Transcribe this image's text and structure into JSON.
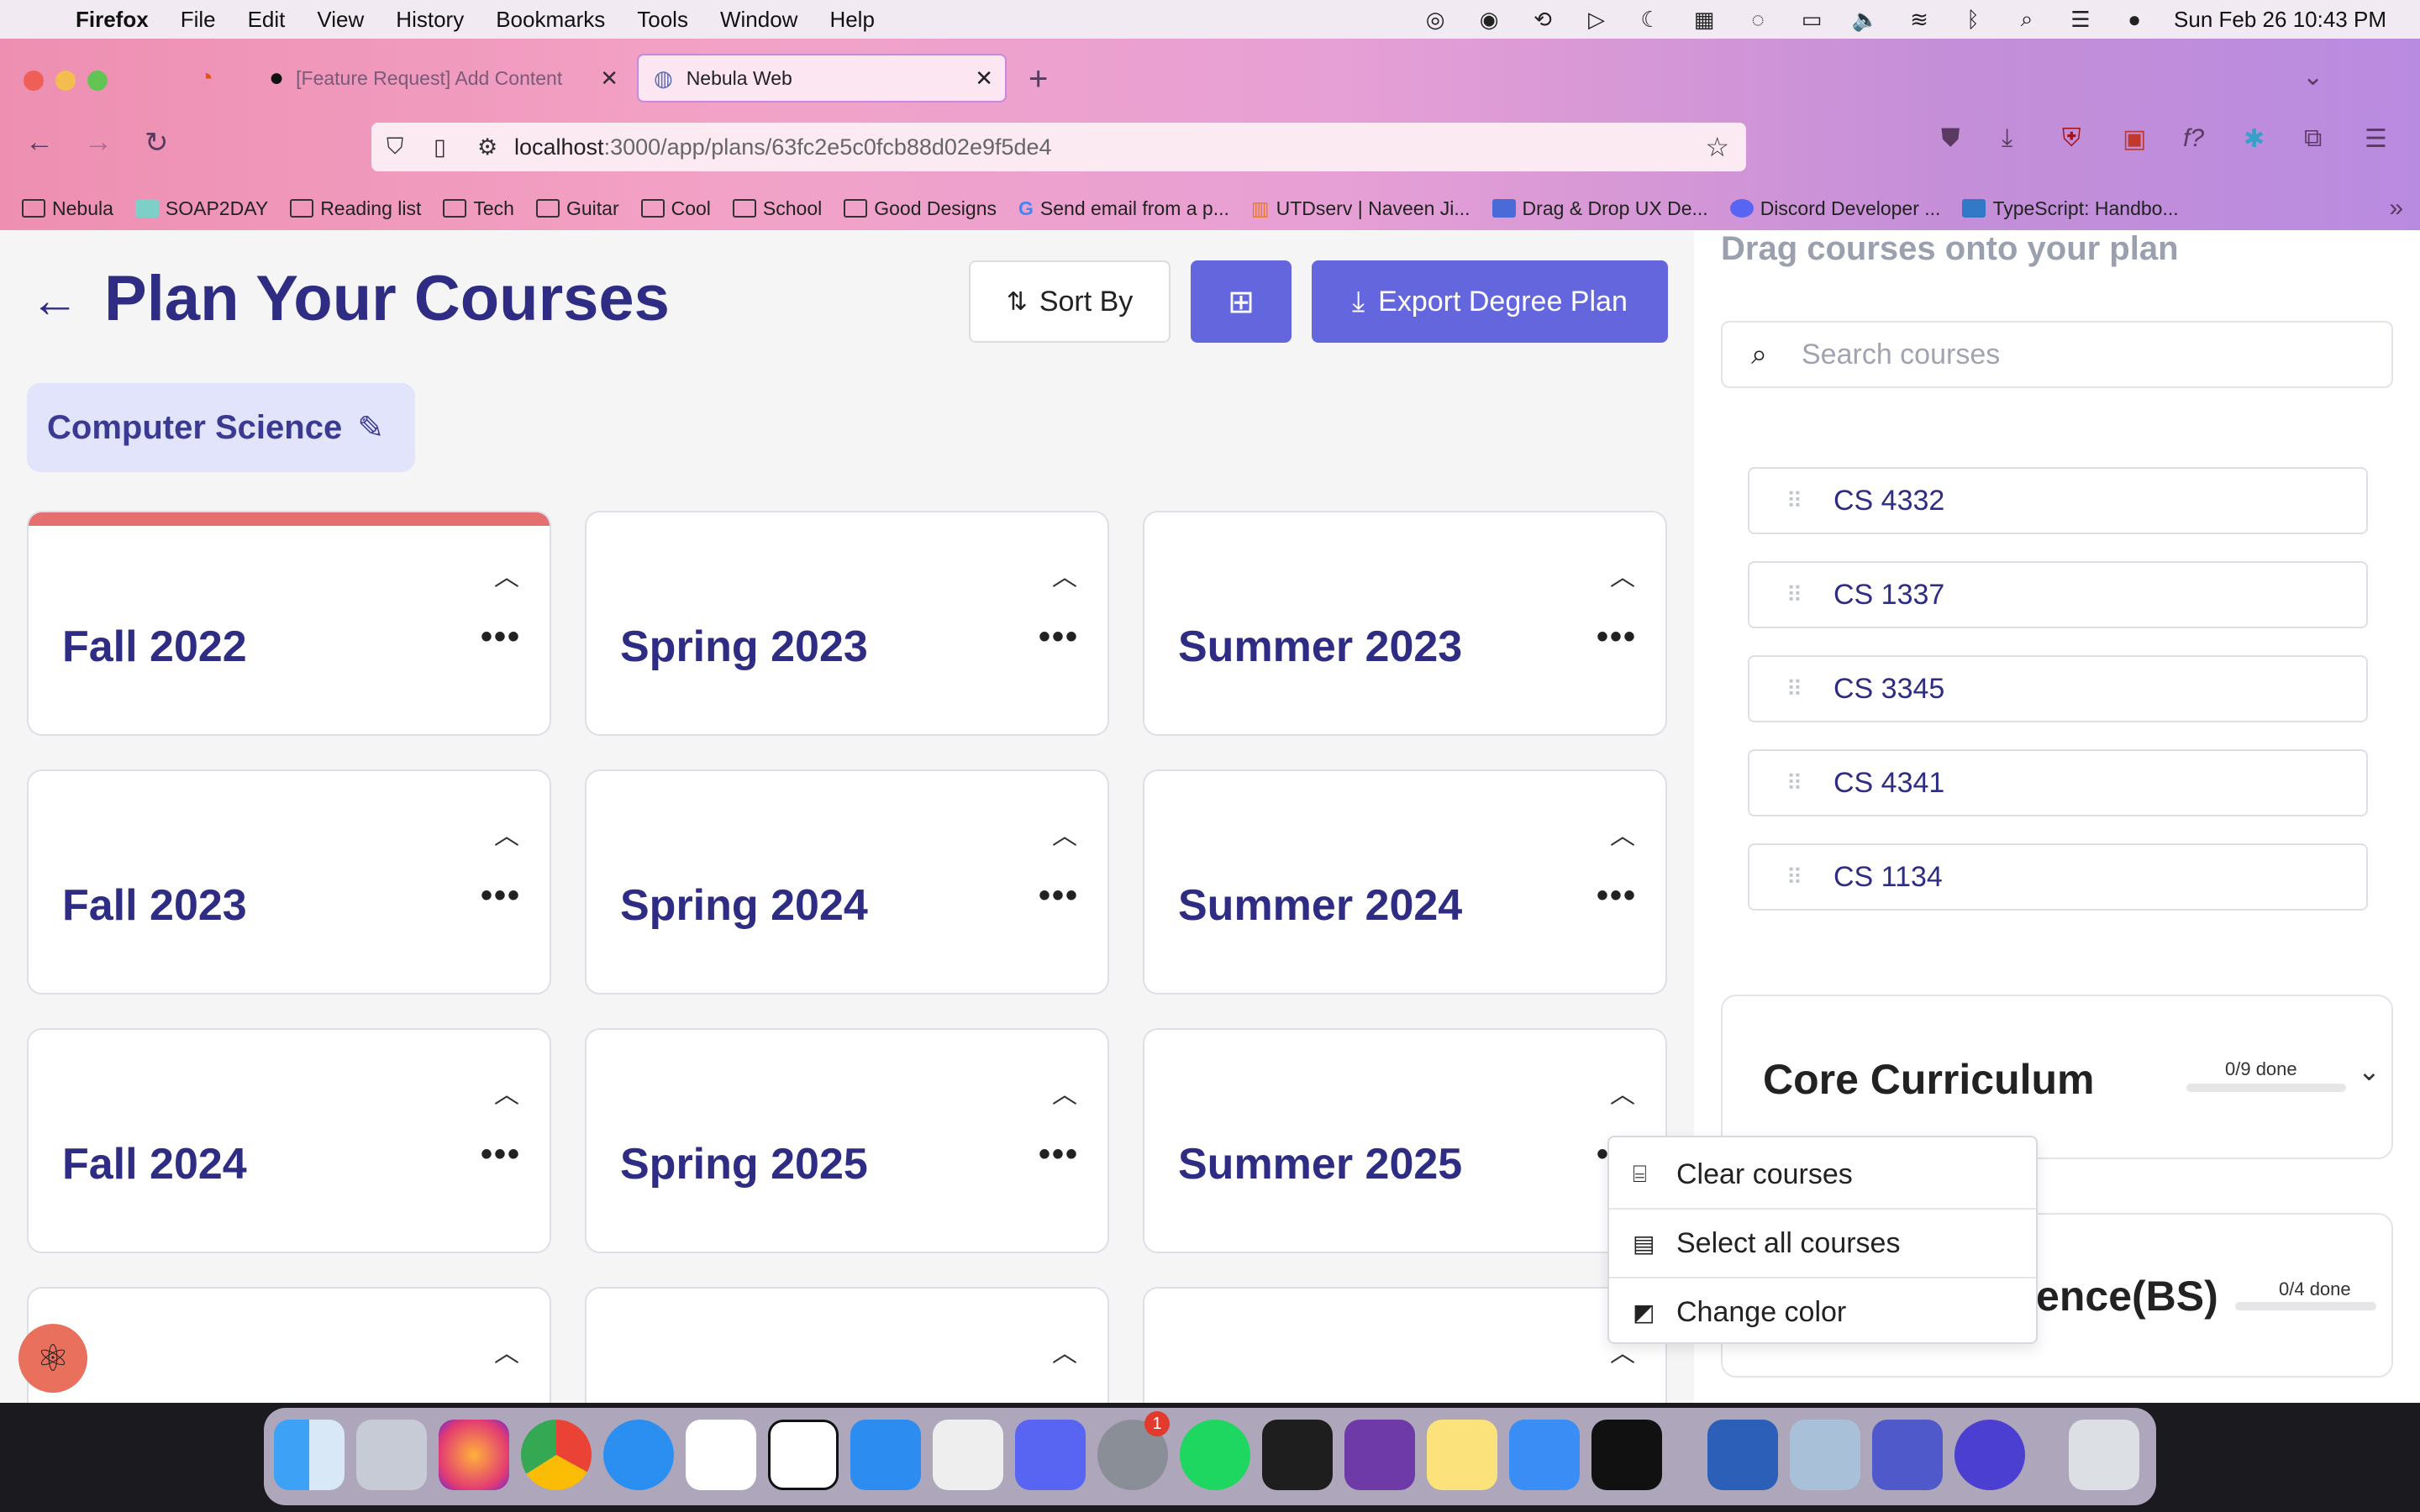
{
  "menubar": {
    "app": "Firefox",
    "items": [
      "File",
      "Edit",
      "View",
      "History",
      "Bookmarks",
      "Tools",
      "Window",
      "Help"
    ],
    "clock": "Sun Feb 26  10:43 PM"
  },
  "tabs": [
    {
      "label": "[Feature Request] Add Content"
    },
    {
      "label": "Nebula Web"
    }
  ],
  "url": {
    "host": "localhost",
    "path": ":3000/app/plans/63fc2e5c0fcb88d02e9f5de4"
  },
  "bookmarks": [
    "Nebula",
    "SOAP2DAY",
    "Reading list",
    "Tech",
    "Guitar",
    "Cool",
    "School",
    "Good Designs",
    "Send email from a p...",
    "UTDserv | Naveen Ji...",
    "Drag & Drop UX De...",
    "Discord Developer ...",
    "TypeScript: Handbo..."
  ],
  "header": {
    "title": "Plan Your Courses",
    "sort_label": "Sort By",
    "export_label": "Export Degree Plan"
  },
  "major": "Computer Science",
  "semesters": [
    "Fall 2022",
    "Spring 2023",
    "Summer 2023",
    "Fall 2023",
    "Spring 2024",
    "Summer 2024",
    "Fall 2024",
    "Spring 2025",
    "Summer 2025"
  ],
  "sidebar": {
    "heading": "Drag courses onto your plan",
    "search_placeholder": "Search courses",
    "courses": [
      "CS 4332",
      "CS 1337",
      "CS 3345",
      "CS 4341",
      "CS 1134"
    ],
    "requirements": [
      {
        "name": "Core Curriculum",
        "progress": "0/9 done",
        "fraction": 0
      },
      {
        "name": "Computer Science(BS)",
        "progress": "0/4 done",
        "fraction": 0
      }
    ]
  },
  "context_menu": {
    "items": [
      "Clear courses",
      "Select all courses",
      "Change color"
    ]
  },
  "colors": {
    "accent": "#6466dd",
    "title": "#2f2d83",
    "warning_bar": "#e56e6e"
  }
}
